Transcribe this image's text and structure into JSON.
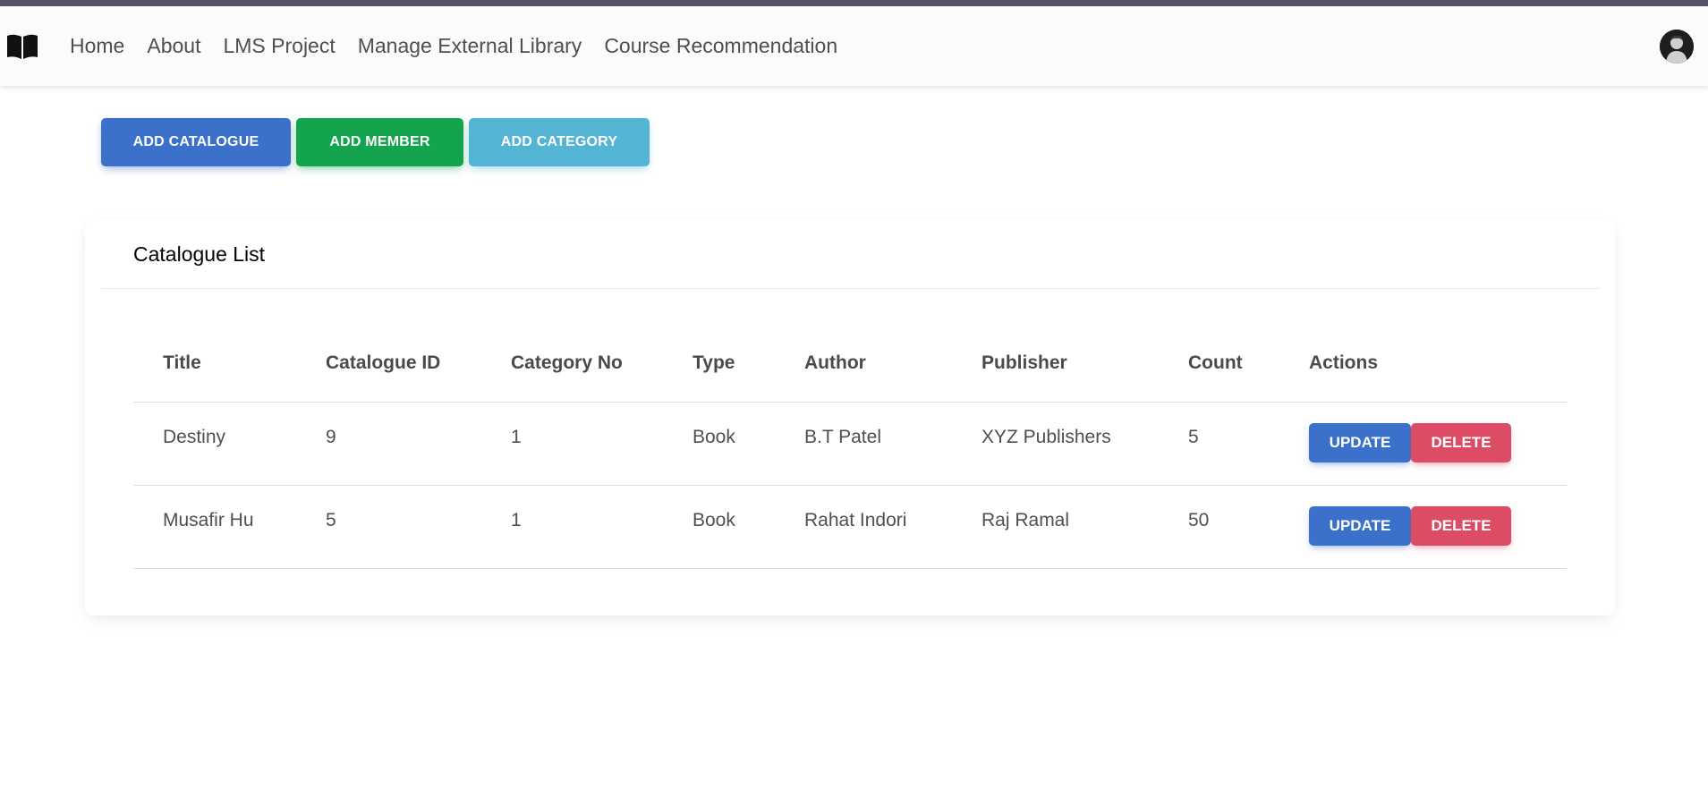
{
  "nav": {
    "items": [
      {
        "label": "Home"
      },
      {
        "label": "About"
      },
      {
        "label": "LMS Project"
      },
      {
        "label": "Manage External Library"
      },
      {
        "label": "Course Recommendation"
      }
    ]
  },
  "actions": {
    "add_catalogue": "ADD CATALOGUE",
    "add_member": "ADD MEMBER",
    "add_category": "ADD CATEGORY"
  },
  "card": {
    "title": "Catalogue List"
  },
  "table": {
    "headers": [
      "Title",
      "Catalogue ID",
      "Category No",
      "Type",
      "Author",
      "Publisher",
      "Count",
      "Actions"
    ],
    "rows": [
      {
        "title": "Destiny",
        "catalogue_id": "9",
        "category_no": "1",
        "type": "Book",
        "author": "B.T Patel",
        "publisher": "XYZ Publishers",
        "count": "5",
        "update": "UPDATE",
        "delete": "DELETE"
      },
      {
        "title": "Musafir Hu",
        "catalogue_id": "5",
        "category_no": "1",
        "type": "Book",
        "author": "Rahat Indori",
        "publisher": "Raj Ramal",
        "count": "50",
        "update": "UPDATE",
        "delete": "DELETE"
      }
    ]
  },
  "colors": {
    "primary": "#3b71ca",
    "success": "#14a44d",
    "info": "#54b4d3",
    "danger": "#dc4c64",
    "top_strip": "#55546a"
  },
  "icons": {
    "brand": "open-book-icon",
    "user": "user-avatar"
  }
}
